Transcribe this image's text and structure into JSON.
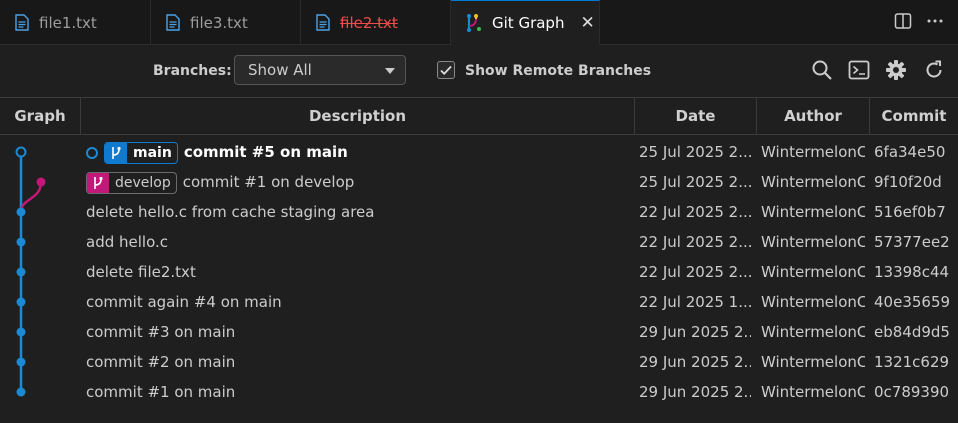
{
  "tabs": [
    {
      "label": "file1.txt",
      "icon": "file-icon"
    },
    {
      "label": "file3.txt",
      "icon": "file-icon"
    },
    {
      "label": "file2.txt",
      "icon": "file-icon",
      "deleted": true
    },
    {
      "label": "Git Graph",
      "icon": "git-graph-icon",
      "active": true
    }
  ],
  "controls": {
    "branches_label": "Branches:",
    "branches_value": "Show All",
    "show_remote_label": "Show Remote Branches",
    "show_remote_checked": true
  },
  "table": {
    "headers": {
      "graph": "Graph",
      "description": "Description",
      "date": "Date",
      "author": "Author",
      "commit": "Commit"
    },
    "rows": [
      {
        "branch": "main",
        "description": "commit #5 on main",
        "date": "25 Jul 2025 2...",
        "author": "WintermelonC",
        "commit": "6fa34e50"
      },
      {
        "branch": "develop",
        "description": "commit #1 on develop",
        "date": "25 Jul 2025 2...",
        "author": "WintermelonC",
        "commit": "9f10f20d"
      },
      {
        "description": "delete hello.c from cache staging area",
        "date": "22 Jul 2025 2...",
        "author": "WintermelonC",
        "commit": "516ef0b7"
      },
      {
        "description": "add hello.c",
        "date": "22 Jul 2025 2...",
        "author": "WintermelonC",
        "commit": "57377ee2"
      },
      {
        "description": "delete file2.txt",
        "date": "22 Jul 2025 2...",
        "author": "WintermelonC",
        "commit": "13398c44"
      },
      {
        "description": "commit again #4 on main",
        "date": "22 Jul 2025 1...",
        "author": "WintermelonC",
        "commit": "40e35659"
      },
      {
        "description": "commit #3 on main",
        "date": "29 Jun 2025 2...",
        "author": "WintermelonC",
        "commit": "eb84d9d5"
      },
      {
        "description": "commit #2 on main",
        "date": "29 Jun 2025 2...",
        "author": "WintermelonC",
        "commit": "1321c629"
      },
      {
        "description": "commit #1 on main",
        "date": "29 Jun 2025 2...",
        "author": "WintermelonC",
        "commit": "0c789390"
      }
    ]
  },
  "colors": {
    "main_branch": "#1a8ad4",
    "develop_branch": "#c2187a",
    "accent": "#0078d4",
    "deleted_file": "#f14c4c"
  },
  "icons": [
    "split-editor-icon",
    "more-icon",
    "search-icon",
    "terminal-icon",
    "settings-icon",
    "refresh-icon",
    "branch-icon",
    "close-icon",
    "checkmark-icon"
  ]
}
